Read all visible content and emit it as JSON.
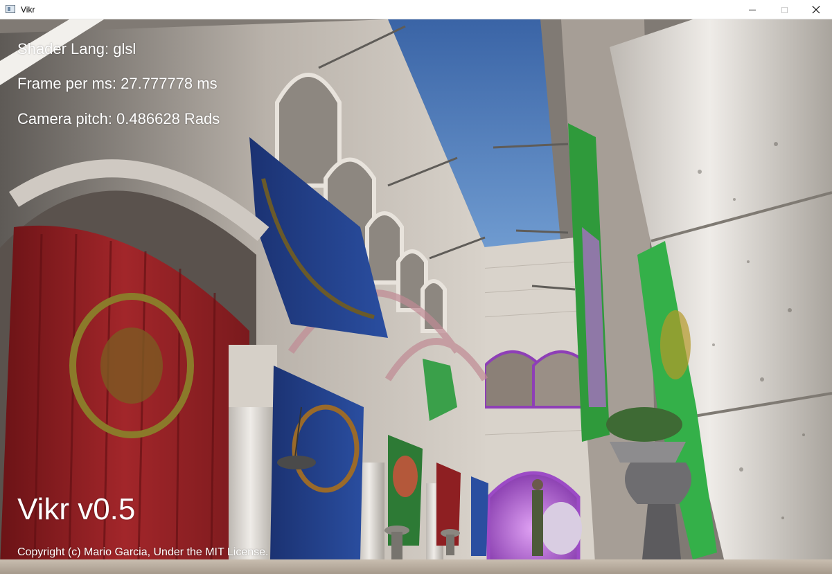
{
  "window": {
    "title": "Vikr",
    "icon": "app-window-icon",
    "controls": [
      "minimize-icon",
      "maximize-icon",
      "close-icon"
    ]
  },
  "hud": {
    "shader_lang": "Shader Lang: glsl",
    "frame_time": "Frame per ms: 27.777778 ms",
    "camera_pitch": "Camera pitch: 0.486628 Rads",
    "version": "Vikr v0.5",
    "copyright": "Copyright (c) Mario Garcia, Under the MIT License."
  },
  "colors": {
    "hud_text": "#ffffff",
    "sky": "#3f6fae",
    "stone": "#d9d4cc",
    "red_drape": "#8e1f22",
    "blue_drape": "#213e84",
    "green_drape": "#2f9a3b",
    "purple_light": "#b86ad6"
  }
}
